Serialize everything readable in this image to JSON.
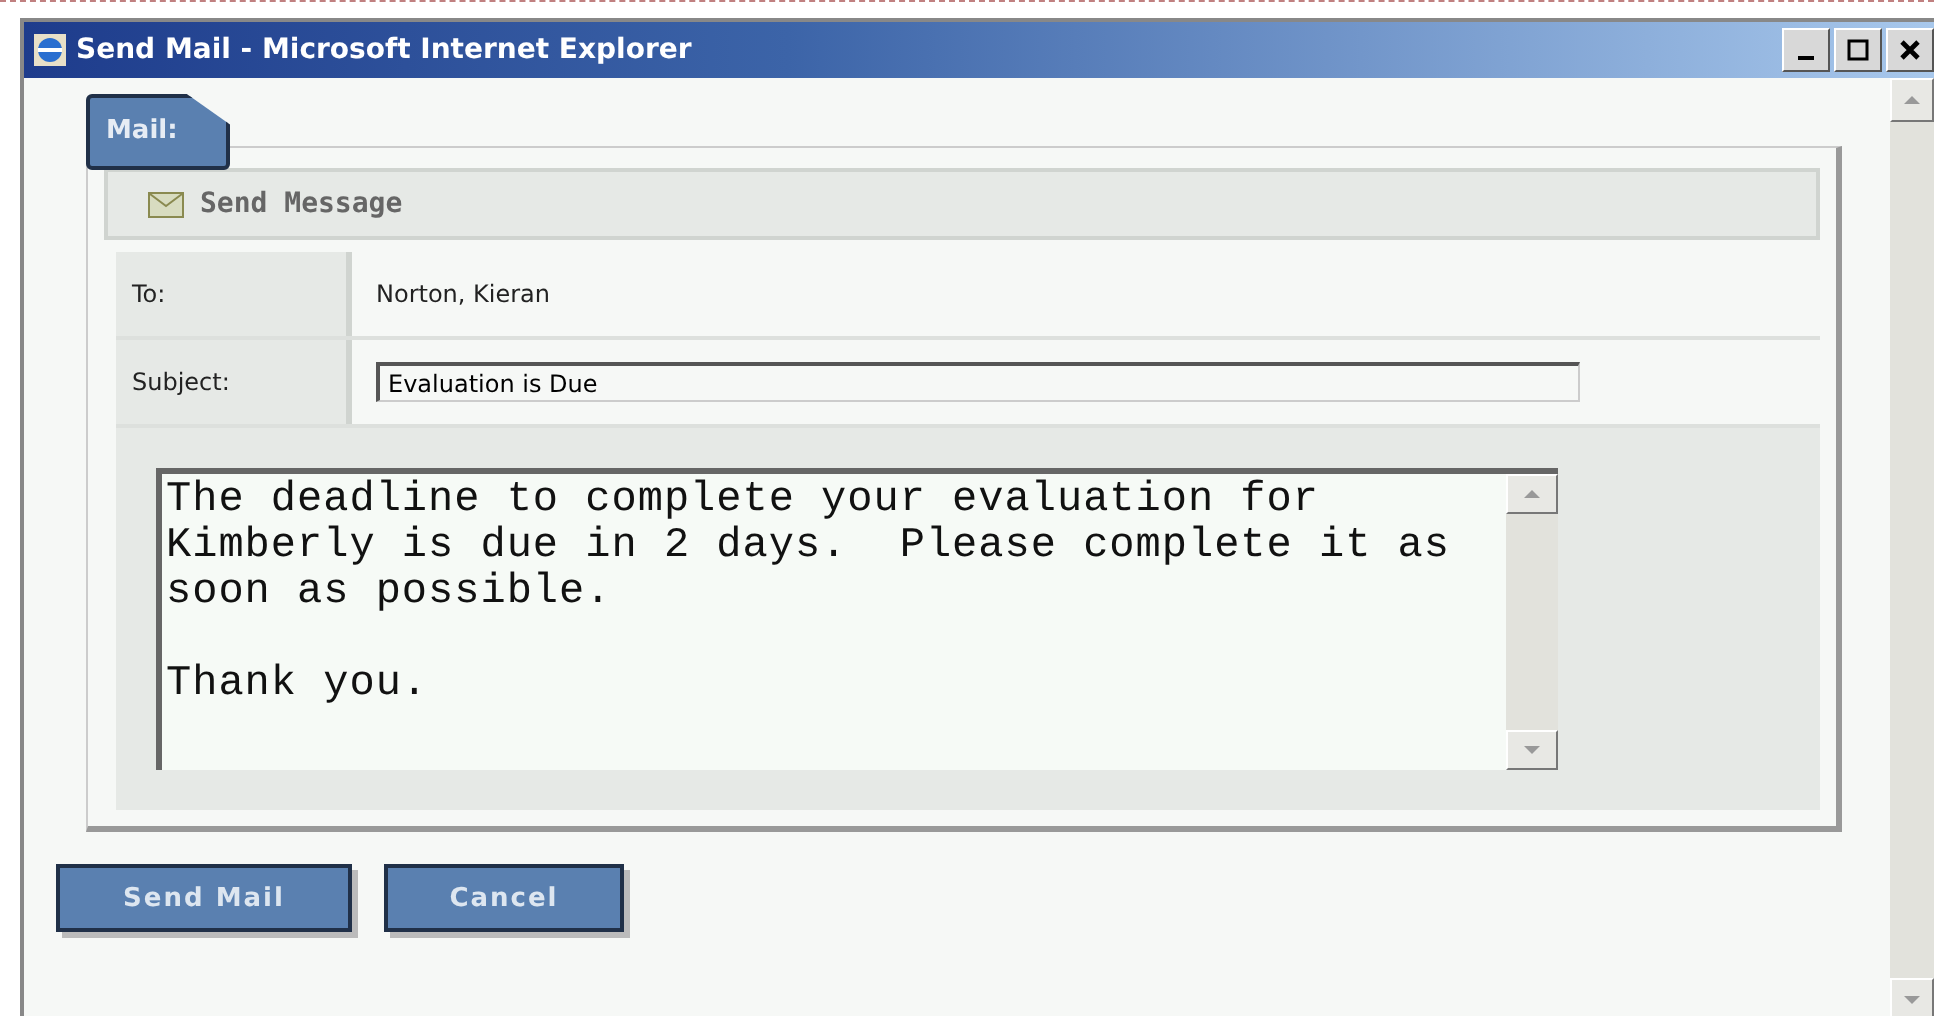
{
  "window": {
    "title": "Send Mail - Microsoft Internet Explorer"
  },
  "tab": {
    "label": "Mail:"
  },
  "panel": {
    "title": "Send Message"
  },
  "fields": [
    {
      "kind": "static",
      "label": "To:",
      "value": "Norton, Kieran"
    },
    {
      "kind": "input",
      "label": "Subject:",
      "value": "Evaluation is Due"
    }
  ],
  "message": "The deadline to complete your evaluation for\nKimberly is due in 2 days.  Please complete it as\nsoon as possible.\n\nThank you.",
  "buttons": [
    "Send Mail",
    "Cancel"
  ]
}
